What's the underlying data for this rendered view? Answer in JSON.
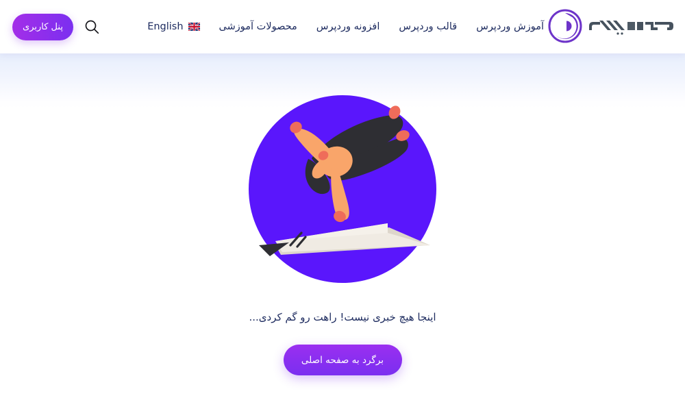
{
  "header": {
    "logo": {
      "name": "میهن وردپرس",
      "mark_icon": "spiral-circle-icon",
      "mark_color": "#6d34c9",
      "word_color": "#46525e"
    },
    "nav_items": [
      {
        "label": "آموزش وردپرس",
        "icon": ""
      },
      {
        "label": "قالب وردپرس",
        "icon": ""
      },
      {
        "label": "افزونه وردپرس",
        "icon": ""
      },
      {
        "label": "محصولات آموزشی",
        "icon": ""
      }
    ],
    "language": {
      "label": "English",
      "icon": "uk-flag-icon"
    },
    "search": {
      "icon": "search-icon",
      "label": "جستجو"
    },
    "panel_button": {
      "label": "پنل کاربری",
      "gradient_from": "#a32ee8",
      "gradient_to": "#7b2ff0"
    }
  },
  "main": {
    "illustration": {
      "icon": "falling-person-paper-plane-illustration",
      "circle_color": "#5a16fc",
      "body_color": "#2e2e33",
      "skin_color": "#f9a56a",
      "accent_color": "#ef6c5a",
      "plane_color": "#f0ebe3",
      "plane_shadow": "#ddd6cb"
    },
    "error_message": "اینجا هیچ خبری نیست! راهت رو گم کردی...",
    "home_button": {
      "label": "برگرد به صفحه اصلی",
      "gradient_from": "#9b2ff0",
      "gradient_to": "#7b2ff0"
    }
  },
  "theme": {
    "text_dark": "#1c2a5e",
    "page_bg": "#ffffff",
    "fade_top": "#e7eefc"
  }
}
